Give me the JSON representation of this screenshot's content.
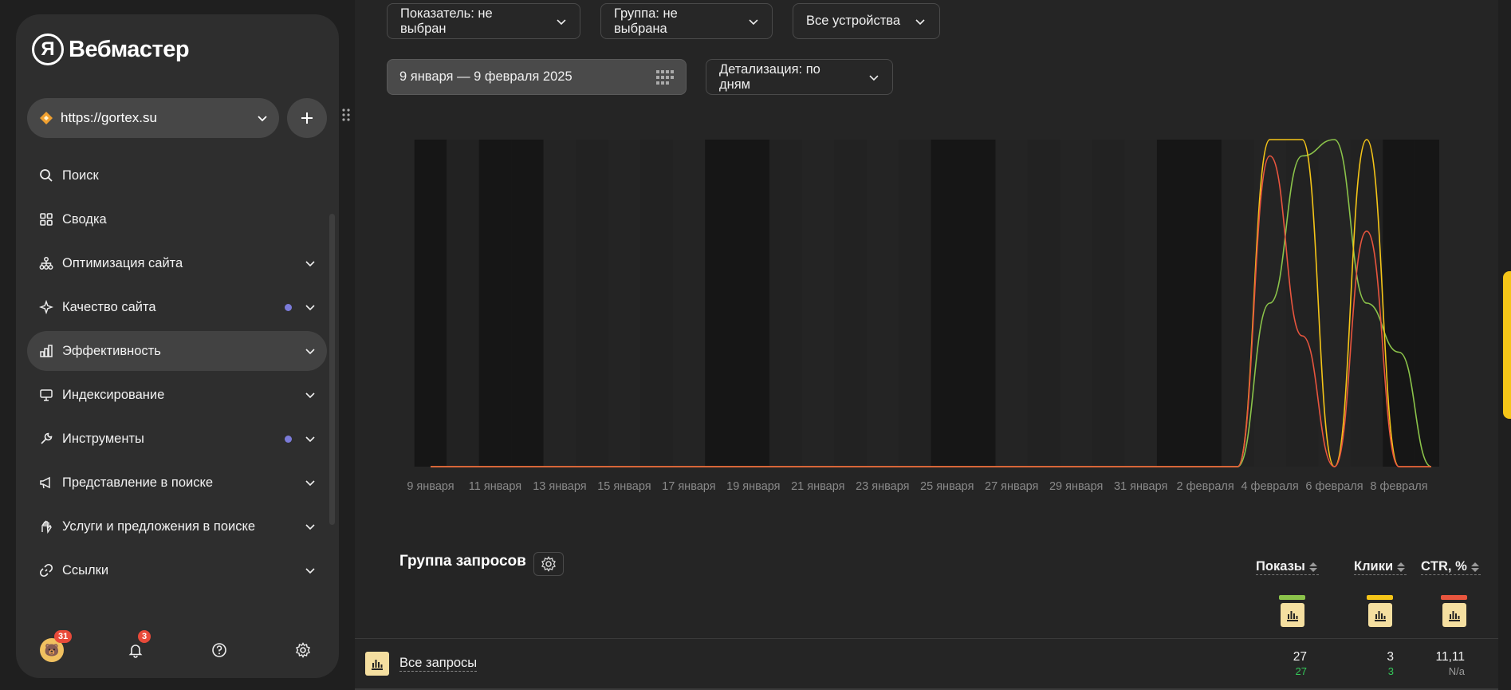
{
  "app": {
    "logo_mark": "Я",
    "logo_text": "Вебмастер"
  },
  "site_selector": {
    "url": "https://gortex.su"
  },
  "nav": {
    "items": [
      {
        "label": "Поиск"
      },
      {
        "label": "Сводка"
      },
      {
        "label": "Оптимизация сайта"
      },
      {
        "label": "Качество сайта"
      },
      {
        "label": "Эффективность"
      },
      {
        "label": "Индексирование"
      },
      {
        "label": "Инструменты"
      },
      {
        "label": "Представление в поиске"
      },
      {
        "label": "Услуги и предложения в поиске"
      },
      {
        "label": "Ссылки"
      }
    ]
  },
  "bottom_bar": {
    "avatar_badge": "31",
    "notifications_badge": "3"
  },
  "filters": {
    "indicator": "Показатель: не выбран",
    "group": "Группа: не выбрана",
    "devices": "Все устройства",
    "date_range": "9 января — 9 февраля 2025",
    "detail": "Детализация: по дням"
  },
  "colors": {
    "shows": "#8bc34a",
    "clicks": "#f5c518",
    "ctr": "#e8553e",
    "accent_dot": "#7b7bd9"
  },
  "chart_data": {
    "type": "line",
    "x_tick_labels": [
      "9 января",
      "11 января",
      "13 января",
      "15 января",
      "17 января",
      "19 января",
      "21 января",
      "23 января",
      "25 января",
      "27 января",
      "29 января",
      "31 января",
      "2 февраля",
      "4 февраля",
      "6 февраля",
      "8 февраля"
    ],
    "x": [
      "9 января",
      "10 января",
      "11 января",
      "12 января",
      "13 января",
      "14 января",
      "15 января",
      "16 января",
      "17 января",
      "18 января",
      "19 января",
      "20 января",
      "21 января",
      "22 января",
      "23 января",
      "24 января",
      "25 января",
      "26 января",
      "27 января",
      "28 января",
      "29 января",
      "30 января",
      "31 января",
      "1 февраля",
      "2 февраля",
      "3 февраля",
      "4 февраля",
      "5 февраля",
      "6 февраля",
      "7 февраля",
      "8 февраля",
      "9 февраля"
    ],
    "series": [
      {
        "values": [
          0,
          0,
          0,
          0,
          0,
          0,
          0,
          0,
          0,
          0,
          0,
          0,
          0,
          0,
          0,
          0,
          0,
          0,
          0,
          0,
          0,
          0,
          0,
          0,
          0,
          0,
          0.5,
          0.95,
          1,
          0.5,
          0.35,
          0
        ]
      },
      {
        "values": [
          0,
          0,
          0,
          0,
          0,
          0,
          0,
          0,
          0,
          0,
          0,
          0,
          0,
          0,
          0,
          0,
          0,
          0,
          0,
          0,
          0,
          0,
          0,
          0,
          0,
          0,
          1,
          1,
          0,
          1,
          0,
          0
        ]
      },
      {
        "values": [
          0,
          0,
          0,
          0,
          0,
          0,
          0,
          0,
          0,
          0,
          0,
          0,
          0,
          0,
          0,
          0,
          0,
          0,
          0,
          0,
          0,
          0,
          0,
          0,
          0,
          0,
          0.95,
          0.4,
          0,
          0.72,
          0,
          0
        ]
      }
    ],
    "shaded_weekend_groups": [
      [
        0,
        0
      ],
      [
        1,
        2
      ],
      [
        4,
        5
      ],
      [
        8,
        9
      ],
      [
        11,
        12
      ],
      [
        14,
        15
      ],
      [
        16,
        17
      ]
    ]
  },
  "query_group": {
    "title": "Группа запросов",
    "columns": [
      {
        "label": "Показы"
      },
      {
        "label": "Клики"
      },
      {
        "label": "CTR, %"
      }
    ],
    "rows": [
      {
        "label": "Все запросы",
        "shows": "27",
        "shows_sub": "27",
        "clicks": "3",
        "clicks_sub": "3",
        "ctr": "11,11",
        "ctr_sub": "N/a"
      }
    ]
  }
}
